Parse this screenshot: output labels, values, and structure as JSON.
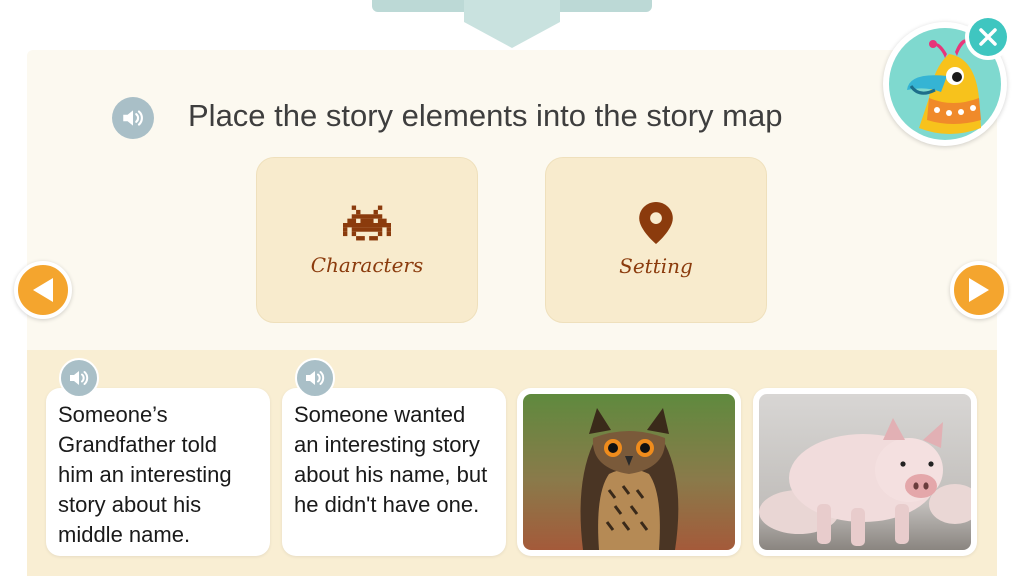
{
  "instruction": {
    "title": "Place the story elements into the story map",
    "speaker_icon": "speaker-icon"
  },
  "story_map": {
    "categories": [
      {
        "label": "Characters",
        "icon": "space-invader-icon"
      },
      {
        "label": "Setting",
        "icon": "map-pin-icon"
      }
    ]
  },
  "navigation": {
    "prev_icon": "triangle-left-icon",
    "next_icon": "triangle-right-icon"
  },
  "avatar": {
    "icon": "parrot-mascot-icon"
  },
  "close": {
    "icon": "close-icon"
  },
  "story_elements": [
    {
      "type": "text",
      "text": "Someone’s Grandfather told him an interesting story about his middle name."
    },
    {
      "type": "text",
      "text": "Someone wanted an interesting story about his name, but he didn't have one."
    },
    {
      "type": "image",
      "subject": "owl-photo"
    },
    {
      "type": "image",
      "subject": "pig-photo"
    }
  ],
  "colors": {
    "accent_orange": "#f4a52e",
    "category_text": "#8b3b0d",
    "close_teal": "#3fc6c0",
    "speaker_grey": "#a9bfc7"
  }
}
